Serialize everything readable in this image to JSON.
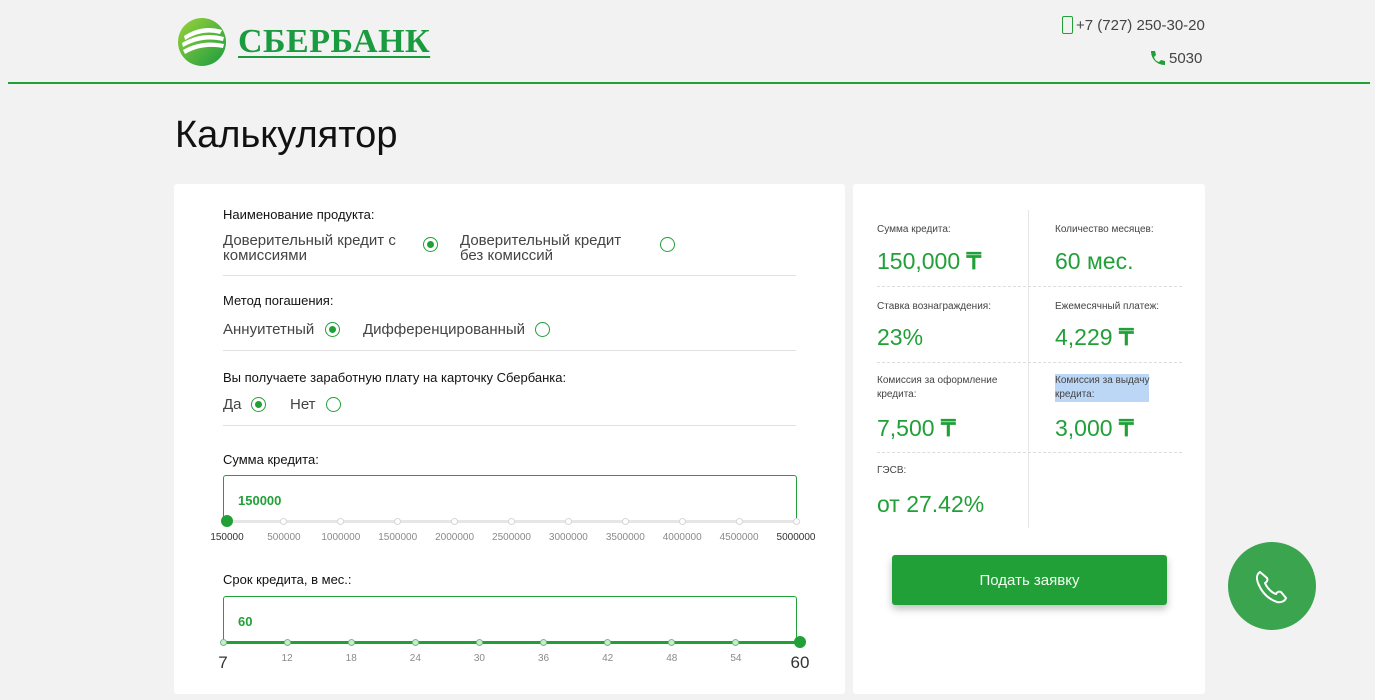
{
  "header": {
    "brand": "СБЕРБАНК",
    "phone_main": "+7 (727) 250-30-20",
    "phone_short": "5030"
  },
  "page_title": "Калькулятор",
  "form": {
    "product": {
      "label": "Наименование продукта:",
      "options": [
        {
          "line1": "Доверительный кредит с",
          "line2": "комиссиями",
          "selected": true
        },
        {
          "line1": "Доверительный кредит",
          "line2": "без комиссий",
          "selected": false
        }
      ]
    },
    "repayment": {
      "label": "Метод погашения:",
      "options": [
        {
          "label": "Аннуитетный",
          "selected": true
        },
        {
          "label": "Дифференцированный",
          "selected": false
        }
      ]
    },
    "salary": {
      "label": "Вы получаете заработную плату на карточку Сбербанка:",
      "options": [
        {
          "label": "Да",
          "selected": true
        },
        {
          "label": "Нет",
          "selected": false
        }
      ]
    },
    "amount": {
      "label": "Сумма кредита:",
      "value": "150000",
      "ticks": [
        "150000",
        "500000",
        "1000000",
        "1500000",
        "2000000",
        "2500000",
        "3000000",
        "3500000",
        "4000000",
        "4500000",
        "5000000"
      ],
      "level": 0
    },
    "term": {
      "label": "Срок кредита, в мес.:",
      "value": "60",
      "ticks": [
        "7",
        "12",
        "18",
        "24",
        "30",
        "36",
        "42",
        "48",
        "54",
        "60"
      ],
      "level": 1
    }
  },
  "summary": {
    "amount_label": "Сумма кредита:",
    "amount_value": "150,000",
    "months_label": "Количество месяцев:",
    "months_value": "60 мес.",
    "rate_label": "Ставка вознаграждения:",
    "rate_value": "23%",
    "payment_label": "Ежемесячный платеж:",
    "payment_value": "4,229",
    "fee_setup_label_1": "Комиссия за оформление",
    "fee_setup_label_2": "кредита:",
    "fee_setup_value": "7,500",
    "fee_issue_label_1": "Комиссия за выдачу",
    "fee_issue_label_2": "кредита:",
    "fee_issue_value": "3,000",
    "apr_label": "ГЭСВ:",
    "apr_value": "от 27.42%",
    "currency": "₸"
  },
  "apply_button": "Подать заявку",
  "colors": {
    "brand": "#21a038",
    "background": "#f2f2f2"
  },
  "icons": {
    "logo": "sber-logo-icon",
    "mobile": "mobile-phone-icon",
    "handset": "phone-handset-icon",
    "call": "call-button-icon"
  }
}
